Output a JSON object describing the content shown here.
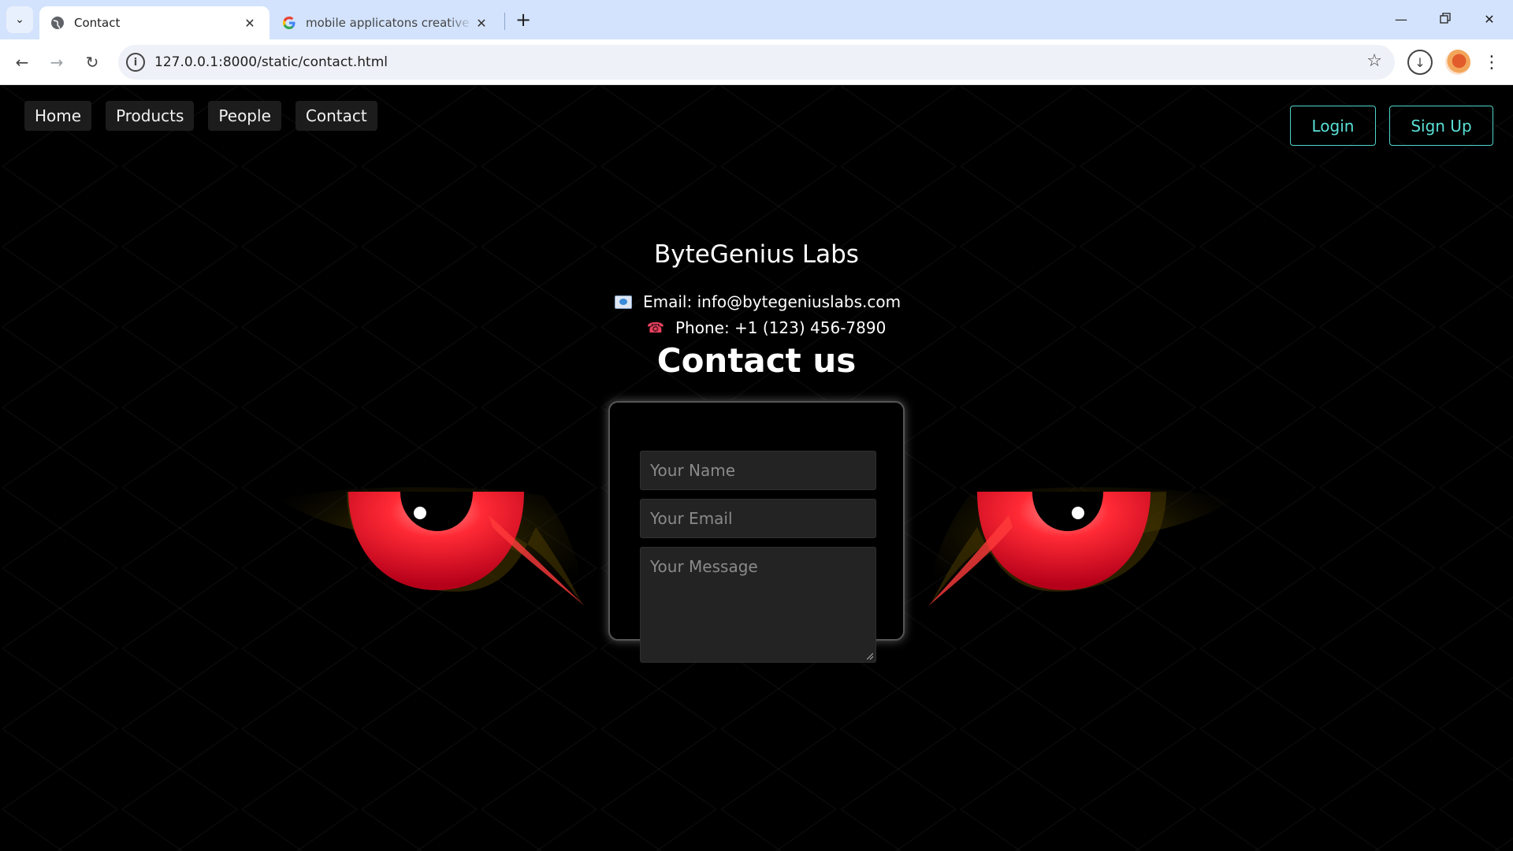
{
  "browser": {
    "tabs": [
      {
        "title": "Contact",
        "active": true
      },
      {
        "title": "mobile applicatons creative design",
        "active": false
      }
    ],
    "url": "127.0.0.1:8000/static/contact.html"
  },
  "nav": {
    "links": [
      "Home",
      "Products",
      "People",
      "Contact"
    ],
    "login": "Login",
    "signup": "Sign Up"
  },
  "contact": {
    "company": "ByteGenius Labs",
    "email_line": "Email: info@bytegeniuslabs.com",
    "phone_line": "Phone: +1 (123) 456-7890",
    "heading": "Contact us"
  },
  "form": {
    "name_placeholder": "Your Name",
    "email_placeholder": "Your Email",
    "message_placeholder": "Your Message"
  },
  "colors": {
    "accent": "#5ae0d6",
    "tabbar": "#d3e3fd",
    "eye_red": "#ff2a35"
  }
}
